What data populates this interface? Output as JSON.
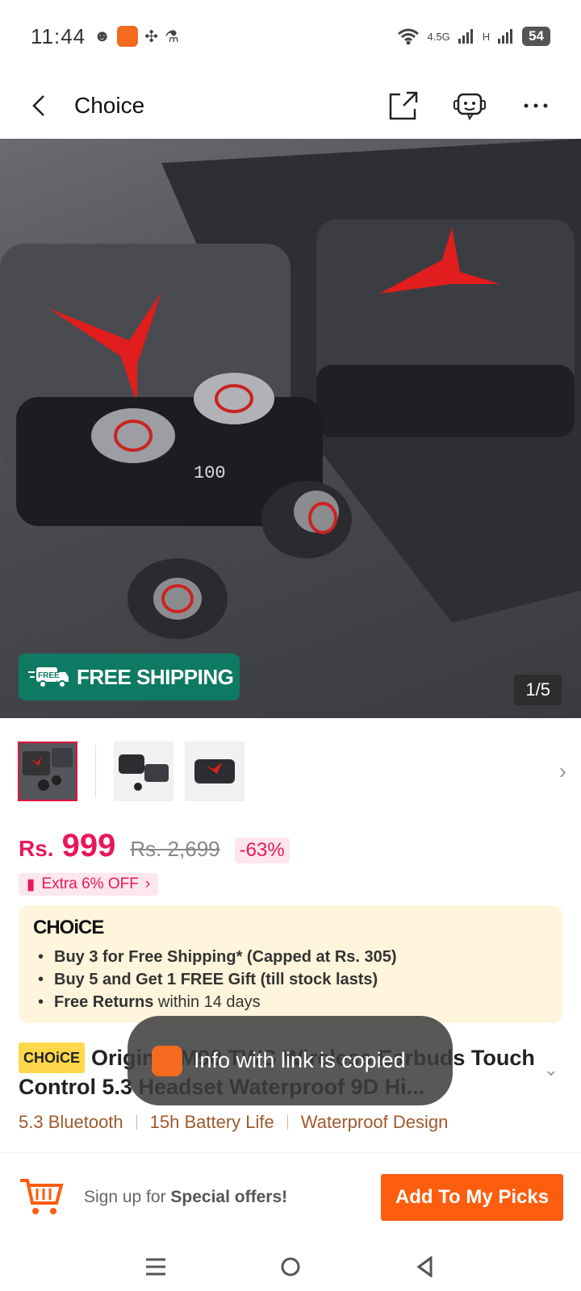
{
  "status_bar": {
    "time": "11:44",
    "network": "4.5G",
    "network2": "H",
    "battery": "54"
  },
  "header": {
    "title": "Choice",
    "icons": [
      "back-icon",
      "share-icon",
      "support-chat-icon",
      "more-icon"
    ]
  },
  "gallery": {
    "badge": "FREE SHIPPING",
    "badge_tag": "FREE",
    "pager": "1/5"
  },
  "price": {
    "currency": "Rs.",
    "amount": "999",
    "original": "Rs. 2,699",
    "discount": "-63%",
    "extra": "Extra 6% OFF"
  },
  "choice_box": {
    "logo": "CHOiCE",
    "benefits": [
      {
        "bold": "Buy 3 for  Free Shipping* (Capped at Rs. 305)",
        "rest": ""
      },
      {
        "bold": "Buy 5 and Get 1 FREE Gift (till stock lasts)",
        "rest": ""
      },
      {
        "bold": "Free Returns",
        "rest": " within 14 days"
      }
    ]
  },
  "product": {
    "tag": "CHOiCE",
    "title": "Original M90 TWS Wireless Earbuds Touch Control 5.3 Headset Waterproof 9D Hi...",
    "features": [
      "5.3 Bluetooth",
      "15h Battery Life",
      "Waterproof Design"
    ]
  },
  "toast": {
    "text": "Info with link is copied"
  },
  "bottom_bar": {
    "signup_prefix": "Sign up for ",
    "signup_bold": "Special offers!",
    "button": "Add To My Picks"
  },
  "colors": {
    "accent": "#fd5d0e",
    "price": "#e8175d",
    "free_shipping": "#0f7a63",
    "choice_bg": "#fff5dc"
  }
}
